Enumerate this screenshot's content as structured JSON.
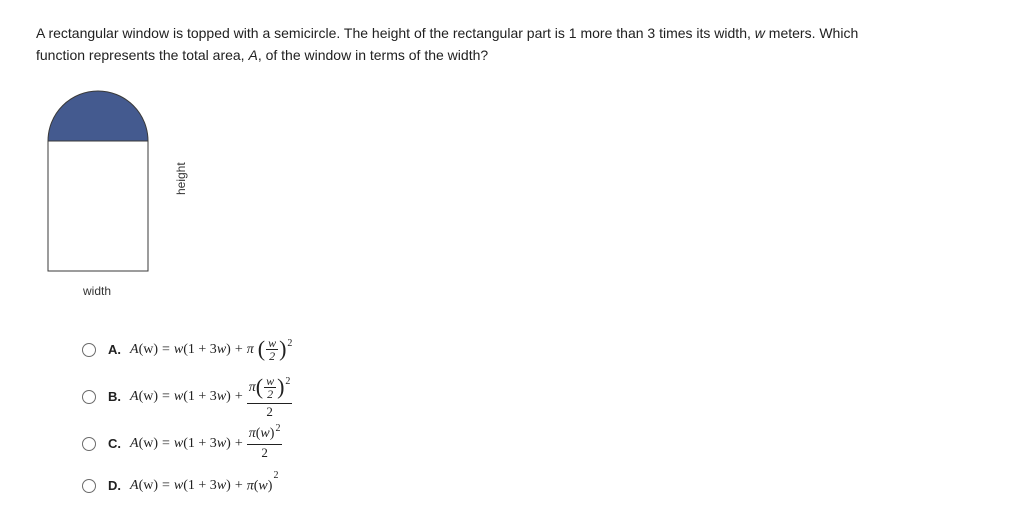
{
  "question": {
    "line1_a": "A rectangular window is topped with a semicircle. The height of the rectangular part is 1 more than 3 times its width, ",
    "width_var": "w",
    "line1_b": " meters. Which",
    "line2_a": "function represents the total area, ",
    "area_var": "A",
    "line2_b": ", of the window in terms of the width?"
  },
  "figure": {
    "width_label": "width",
    "height_label": "height"
  },
  "choices": {
    "A": {
      "letter": "A."
    },
    "B": {
      "letter": "B."
    },
    "C": {
      "letter": "C."
    },
    "D": {
      "letter": "D."
    }
  },
  "formula_parts": {
    "Aw": "A",
    "open_w": "(w)",
    "eq": " = ",
    "w": "w",
    "open": "(1 + 3",
    "w2": "w",
    "close": ")",
    "plus": " + ",
    "pi": "π",
    "half_num": "w",
    "half_den": "2",
    "sq": "2",
    "den2": "2",
    "w_in_paren": "(w)"
  }
}
